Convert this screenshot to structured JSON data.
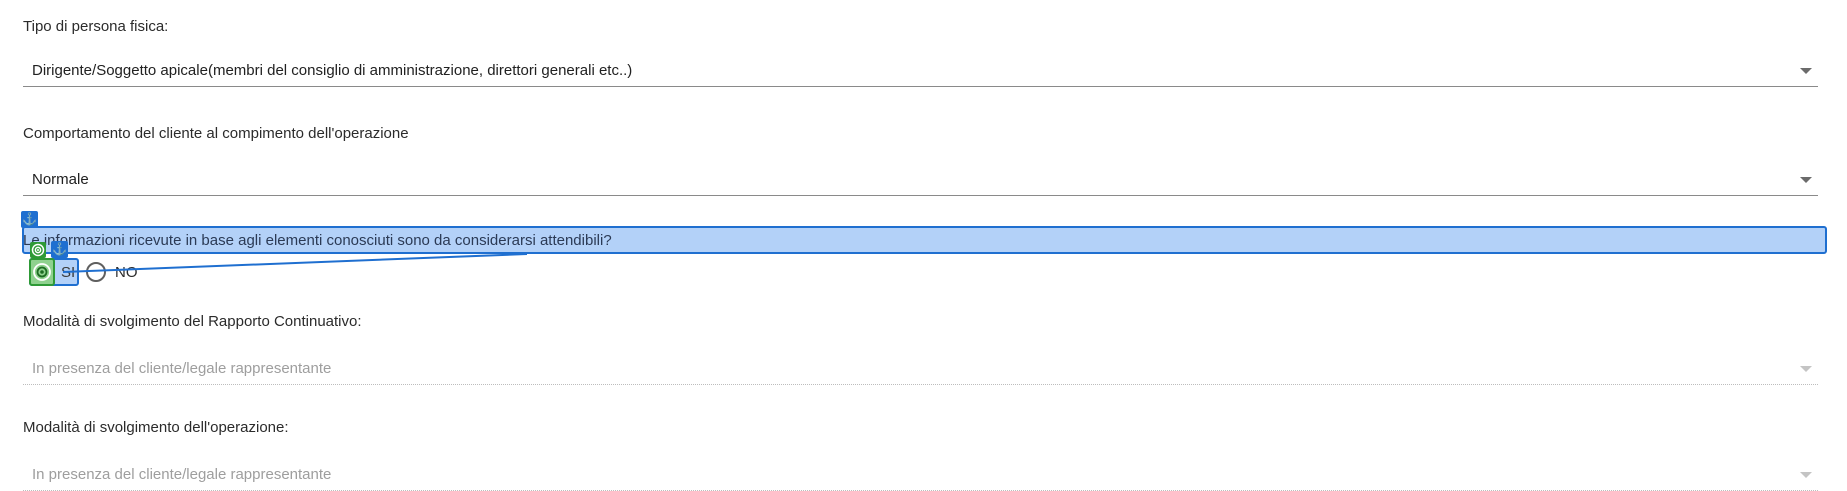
{
  "fields": {
    "tipo_persona": {
      "label": "Tipo di persona fisica:",
      "value": "Dirigente/Soggetto apicale(membri del consiglio di amministrazione, direttori generali etc..)"
    },
    "comportamento": {
      "label": "Comportamento del cliente al compimento dell'operazione",
      "value": "Normale"
    },
    "informazioni": {
      "label": "Le informazioni ricevute in base agli elementi conosciuti sono da considerarsi attendibili?",
      "options": [
        "SI",
        "NO"
      ]
    },
    "modalita_rapporto": {
      "label": "Modalità di svolgimento del Rapporto Continuativo:",
      "value": "In presenza del cliente/legale rappresentante"
    },
    "modalita_operazione": {
      "label": "Modalità di svolgimento dell'operazione:",
      "value": "In presenza del cliente/legale rappresentante"
    }
  },
  "overlay": {
    "anchor_glyph": "⚓",
    "accent_blue": "#1f6fd0",
    "accent_green": "#2e9a36",
    "highlight_fill": "#b3d1f8"
  },
  "icons": {
    "anchor": "anchor-icon",
    "target": "target-icon",
    "caret": "chevron-down-icon"
  }
}
